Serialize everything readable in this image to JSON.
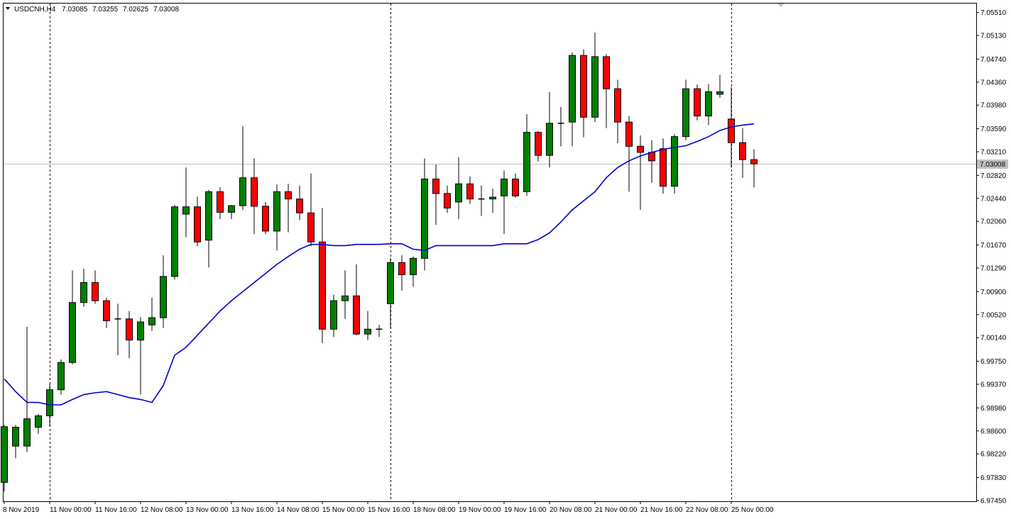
{
  "chart_data": {
    "type": "candlestick",
    "header": {
      "symbol": "USDCNH,H4",
      "open": "7.03085",
      "high": "7.03255",
      "low": "7.02625",
      "close": "7.03008"
    },
    "current_price": 7.03008,
    "current_price_label": "7.03008",
    "ylim": [
      6.9745,
      7.0554
    ],
    "y_ticks": [
      "7.05510",
      "7.05130",
      "7.04740",
      "7.04360",
      "7.03980",
      "7.03590",
      "7.03210",
      "7.02820",
      "7.02440",
      "7.02060",
      "7.01670",
      "7.01290",
      "7.00900",
      "7.00520",
      "7.00140",
      "6.99750",
      "6.99370",
      "6.98980",
      "6.98600",
      "6.98220",
      "6.97830",
      "6.97450"
    ],
    "x_labels": [
      {
        "label": "8 Nov 2019",
        "i": 0
      },
      {
        "label": "11 Nov 00:00",
        "i": 4
      },
      {
        "label": "11 Nov 16:00",
        "i": 8
      },
      {
        "label": "12 Nov 08:00",
        "i": 12
      },
      {
        "label": "13 Nov 00:00",
        "i": 16
      },
      {
        "label": "13 Nov 16:00",
        "i": 20
      },
      {
        "label": "14 Nov 08:00",
        "i": 24
      },
      {
        "label": "15 Nov 00:00",
        "i": 28
      },
      {
        "label": "15 Nov 16:00",
        "i": 32
      },
      {
        "label": "18 Nov 08:00",
        "i": 36
      },
      {
        "label": "19 Nov 00:00",
        "i": 40
      },
      {
        "label": "19 Nov 16:00",
        "i": 44
      },
      {
        "label": "20 Nov 08:00",
        "i": 48
      },
      {
        "label": "21 Nov 00:00",
        "i": 52
      },
      {
        "label": "21 Nov 16:00",
        "i": 56
      },
      {
        "label": "22 Nov 08:00",
        "i": 60
      },
      {
        "label": "25 Nov 00:00",
        "i": 64
      }
    ],
    "week_separators": [
      4,
      34,
      64
    ],
    "colors": {
      "bull": "#008000",
      "bear": "#ff0000",
      "ma": "#0000cd",
      "wick": "#000000",
      "grid_price": "#c0c0c0"
    },
    "candles": [
      {
        "o": 6.9775,
        "h": 6.987,
        "l": 6.976,
        "c": 6.9867
      },
      {
        "o": 6.9835,
        "h": 6.987,
        "l": 6.9815,
        "c": 6.9866
      },
      {
        "o": 6.9835,
        "h": 7.0032,
        "l": 6.9825,
        "c": 6.988
      },
      {
        "o": 6.9866,
        "h": 6.9888,
        "l": 6.9855,
        "c": 6.9885
      },
      {
        "o": 6.9885,
        "h": 6.9938,
        "l": 6.9868,
        "c": 6.9928
      },
      {
        "o": 6.9928,
        "h": 6.9978,
        "l": 6.992,
        "c": 6.9973
      },
      {
        "o": 6.9973,
        "h": 7.0125,
        "l": 6.997,
        "c": 7.0072
      },
      {
        "o": 7.0072,
        "h": 7.0128,
        "l": 7.0065,
        "c": 7.0105
      },
      {
        "o": 7.0105,
        "h": 7.0125,
        "l": 7.007,
        "c": 7.0075
      },
      {
        "o": 7.0075,
        "h": 7.008,
        "l": 7.003,
        "c": 7.0042
      },
      {
        "o": 7.0045,
        "h": 7.007,
        "l": 6.9985,
        "c": 7.0045
      },
      {
        "o": 7.0045,
        "h": 7.0058,
        "l": 6.998,
        "c": 7.001
      },
      {
        "o": 7.001,
        "h": 7.0048,
        "l": 6.992,
        "c": 7.004
      },
      {
        "o": 7.0035,
        "h": 7.008,
        "l": 7.0025,
        "c": 7.0047
      },
      {
        "o": 7.0047,
        "h": 7.015,
        "l": 7.003,
        "c": 7.0115
      },
      {
        "o": 7.0115,
        "h": 7.0233,
        "l": 7.011,
        "c": 7.023
      },
      {
        "o": 7.0218,
        "h": 7.0295,
        "l": 7.018,
        "c": 7.023
      },
      {
        "o": 7.023,
        "h": 7.0247,
        "l": 7.0165,
        "c": 7.0172
      },
      {
        "o": 7.0175,
        "h": 7.0258,
        "l": 7.013,
        "c": 7.0255
      },
      {
        "o": 7.0255,
        "h": 7.0262,
        "l": 7.021,
        "c": 7.0221
      },
      {
        "o": 7.0221,
        "h": 7.0233,
        "l": 7.021,
        "c": 7.0232
      },
      {
        "o": 7.0232,
        "h": 7.0363,
        "l": 7.0225,
        "c": 7.0278
      },
      {
        "o": 7.0278,
        "h": 7.031,
        "l": 7.0185,
        "c": 7.0231
      },
      {
        "o": 7.0231,
        "h": 7.0238,
        "l": 7.0185,
        "c": 7.019
      },
      {
        "o": 7.019,
        "h": 7.0267,
        "l": 7.0158,
        "c": 7.0255
      },
      {
        "o": 7.0255,
        "h": 7.0268,
        "l": 7.0188,
        "c": 7.0243
      },
      {
        "o": 7.0243,
        "h": 7.0265,
        "l": 7.0208,
        "c": 7.022
      },
      {
        "o": 7.022,
        "h": 7.0285,
        "l": 7.0165,
        "c": 7.0172
      },
      {
        "o": 7.0172,
        "h": 7.0228,
        "l": 7.0005,
        "c": 7.0028
      },
      {
        "o": 7.0028,
        "h": 7.0085,
        "l": 7.0015,
        "c": 7.0075
      },
      {
        "o": 7.0075,
        "h": 7.0125,
        "l": 7.0045,
        "c": 7.0083
      },
      {
        "o": 7.0083,
        "h": 7.0135,
        "l": 7.0018,
        "c": 7.002
      },
      {
        "o": 7.002,
        "h": 7.0058,
        "l": 7.001,
        "c": 7.0028
      },
      {
        "o": 7.0028,
        "h": 7.0035,
        "l": 7.0015,
        "c": 7.0028
      },
      {
        "o": 7.007,
        "h": 7.0145,
        "l": 7.003,
        "c": 7.0138
      },
      {
        "o": 7.0138,
        "h": 7.015,
        "l": 7.0092,
        "c": 7.0118
      },
      {
        "o": 7.0118,
        "h": 7.0148,
        "l": 7.0098,
        "c": 7.0145
      },
      {
        "o": 7.0145,
        "h": 7.031,
        "l": 7.0125,
        "c": 7.0276
      },
      {
        "o": 7.0276,
        "h": 7.03,
        "l": 7.02,
        "c": 7.0252
      },
      {
        "o": 7.0252,
        "h": 7.0265,
        "l": 7.022,
        "c": 7.0228
      },
      {
        "o": 7.0238,
        "h": 7.0312,
        "l": 7.021,
        "c": 7.0268
      },
      {
        "o": 7.0268,
        "h": 7.028,
        "l": 7.0235,
        "c": 7.0243
      },
      {
        "o": 7.0243,
        "h": 7.0265,
        "l": 7.0215,
        "c": 7.0243
      },
      {
        "o": 7.0243,
        "h": 7.026,
        "l": 7.022,
        "c": 7.0246
      },
      {
        "o": 7.0248,
        "h": 7.029,
        "l": 7.0185,
        "c": 7.0276
      },
      {
        "o": 7.0276,
        "h": 7.0285,
        "l": 7.0245,
        "c": 7.0248
      },
      {
        "o": 7.0255,
        "h": 7.0383,
        "l": 7.0248,
        "c": 7.0353
      },
      {
        "o": 7.0353,
        "h": 7.0355,
        "l": 7.0305,
        "c": 7.0315
      },
      {
        "o": 7.0315,
        "h": 7.042,
        "l": 7.0295,
        "c": 7.0368
      },
      {
        "o": 7.0368,
        "h": 7.0395,
        "l": 7.033,
        "c": 7.0368
      },
      {
        "o": 7.037,
        "h": 7.0485,
        "l": 7.033,
        "c": 7.048
      },
      {
        "o": 7.048,
        "h": 7.049,
        "l": 7.0345,
        "c": 7.0378
      },
      {
        "o": 7.0378,
        "h": 7.0518,
        "l": 7.037,
        "c": 7.0478
      },
      {
        "o": 7.0478,
        "h": 7.0482,
        "l": 7.036,
        "c": 7.0425
      },
      {
        "o": 7.0425,
        "h": 7.044,
        "l": 7.0335,
        "c": 7.037
      },
      {
        "o": 7.037,
        "h": 7.038,
        "l": 7.0255,
        "c": 7.033
      },
      {
        "o": 7.033,
        "h": 7.0348,
        "l": 7.0225,
        "c": 7.032
      },
      {
        "o": 7.032,
        "h": 7.034,
        "l": 7.027,
        "c": 7.0306
      },
      {
        "o": 7.0326,
        "h": 7.0343,
        "l": 7.0252,
        "c": 7.0264
      },
      {
        "o": 7.0264,
        "h": 7.035,
        "l": 7.0252,
        "c": 7.0346
      },
      {
        "o": 7.0346,
        "h": 7.044,
        "l": 7.034,
        "c": 7.0425
      },
      {
        "o": 7.0425,
        "h": 7.0432,
        "l": 7.0373,
        "c": 7.038
      },
      {
        "o": 7.038,
        "h": 7.0433,
        "l": 7.0365,
        "c": 7.042
      },
      {
        "o": 7.0416,
        "h": 7.0448,
        "l": 7.041,
        "c": 7.042
      },
      {
        "o": 7.0375,
        "h": 7.0428,
        "l": 7.0295,
        "c": 7.0336
      },
      {
        "o": 7.0336,
        "h": 7.036,
        "l": 7.0278,
        "c": 7.0308
      },
      {
        "o": 7.0308,
        "h": 7.0325,
        "l": 7.0262,
        "c": 7.0301
      }
    ],
    "ma": [
      6.9946,
      6.9925,
      6.9907,
      6.9907,
      6.9903,
      6.9903,
      6.9912,
      6.992,
      6.9923,
      6.9925,
      6.992,
      6.9915,
      6.9912,
      6.9907,
      6.9935,
      6.9985,
      6.9998,
      7.0018,
      7.0038,
      7.0058,
      7.0075,
      7.009,
      7.0105,
      7.012,
      7.0135,
      7.0148,
      7.016,
      7.0168,
      7.0168,
      7.0166,
      7.0166,
      7.0168,
      7.0168,
      7.0168,
      7.0169,
      7.0169,
      7.016,
      7.0158,
      7.0166,
      7.0166,
      7.0166,
      7.0166,
      7.0166,
      7.0166,
      7.0169,
      7.0169,
      7.0169,
      7.0176,
      7.0187,
      7.0205,
      7.0225,
      7.024,
      7.0255,
      7.0278,
      7.0295,
      7.0306,
      7.0314,
      7.032,
      7.0325,
      7.0328,
      7.0331,
      7.0338,
      7.0346,
      7.0356,
      7.0362,
      7.0365,
      7.0367
    ]
  }
}
